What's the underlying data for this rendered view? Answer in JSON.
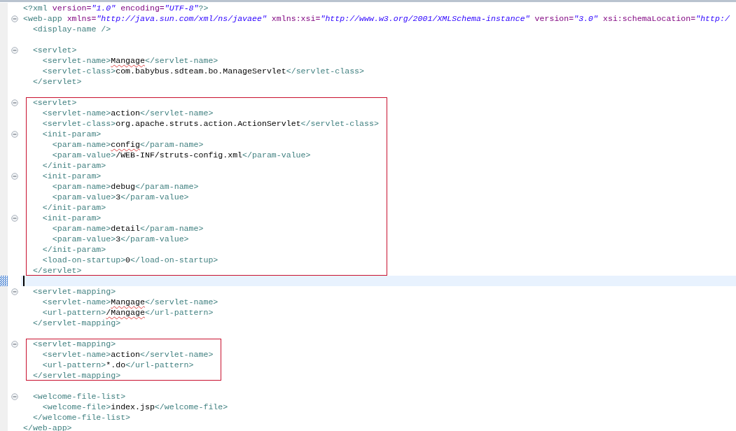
{
  "editor": {
    "lines": [
      {
        "kind": "code",
        "foldable": false,
        "current": false,
        "tokens": [
          {
            "kind": "pi",
            "text": "<?xml "
          },
          {
            "kind": "attr",
            "text": "version="
          },
          {
            "kind": "value",
            "text": "\"1.0\""
          },
          {
            "kind": "attr",
            "text": " encoding="
          },
          {
            "kind": "value",
            "text": "\"UTF-8\""
          },
          {
            "kind": "pi",
            "text": "?>"
          }
        ]
      },
      {
        "kind": "code",
        "foldable": true,
        "current": false,
        "tokens": [
          {
            "kind": "tag",
            "text": "<web-app"
          },
          {
            "kind": "attr",
            "text": " xmlns="
          },
          {
            "kind": "value",
            "text": "\"http://java.sun.com/xml/ns/javaee\""
          },
          {
            "kind": "attr",
            "text": " xmlns:xsi="
          },
          {
            "kind": "value",
            "text": "\"http://www.w3.org/2001/XMLSchema-instance\""
          },
          {
            "kind": "attr",
            "text": " version="
          },
          {
            "kind": "value",
            "text": "\"3.0\""
          },
          {
            "kind": "attr",
            "text": " xsi:schemaLocation="
          },
          {
            "kind": "value",
            "text": "\"http:/"
          }
        ],
        "children": [
          {
            "kind": "code",
            "foldable": false,
            "current": false,
            "tokens": [
              {
                "kind": "tag",
                "text": "<display-name />"
              }
            ]
          },
          {
            "kind": "blank",
            "foldable": false,
            "current": false
          },
          {
            "kind": "code",
            "foldable": true,
            "current": false,
            "tokens": [
              {
                "kind": "tag",
                "text": "<servlet>"
              }
            ],
            "children": [
              {
                "kind": "code",
                "foldable": false,
                "current": false,
                "tokens": [
                  {
                    "kind": "tag",
                    "text": "<servlet-name>"
                  },
                  {
                    "kind": "text",
                    "text": "Mangage",
                    "misspelled": true
                  },
                  {
                    "kind": "tag",
                    "text": "</servlet-name>"
                  }
                ]
              },
              {
                "kind": "code",
                "foldable": false,
                "current": false,
                "tokens": [
                  {
                    "kind": "tag",
                    "text": "<servlet-class>"
                  },
                  {
                    "kind": "text",
                    "text": "com.babybus.sdteam.bo.ManageServlet",
                    "misspelled": false
                  },
                  {
                    "kind": "tag",
                    "text": "</servlet-class>"
                  }
                ]
              }
            ]
          },
          {
            "kind": "code",
            "foldable": false,
            "current": false,
            "tokens": [
              {
                "kind": "tag",
                "text": "</servlet>"
              }
            ]
          },
          {
            "kind": "blank",
            "foldable": false,
            "current": false
          },
          {
            "kind": "frame",
            "lines": [
              {
                "kind": "code",
                "foldable": true,
                "current": false,
                "tokens": [
                  {
                    "kind": "tag",
                    "text": "<servlet>"
                  }
                ],
                "children": [
                  {
                    "kind": "code",
                    "foldable": false,
                    "current": false,
                    "tokens": [
                      {
                        "kind": "tag",
                        "text": "<servlet-name>"
                      },
                      {
                        "kind": "text",
                        "text": "action",
                        "misspelled": false
                      },
                      {
                        "kind": "tag",
                        "text": "</servlet-name>"
                      }
                    ]
                  },
                  {
                    "kind": "code",
                    "foldable": false,
                    "current": false,
                    "tokens": [
                      {
                        "kind": "tag",
                        "text": "<servlet-class>"
                      },
                      {
                        "kind": "text",
                        "text": "org.apache.struts.action.ActionServlet",
                        "misspelled": false
                      },
                      {
                        "kind": "tag",
                        "text": "</servlet-class>"
                      }
                    ]
                  },
                  {
                    "kind": "code",
                    "foldable": true,
                    "current": false,
                    "tokens": [
                      {
                        "kind": "tag",
                        "text": "<init-param>"
                      }
                    ],
                    "children": [
                      {
                        "kind": "code",
                        "foldable": false,
                        "current": false,
                        "tokens": [
                          {
                            "kind": "tag",
                            "text": "<param-name>"
                          },
                          {
                            "kind": "text",
                            "text": "config",
                            "misspelled": true
                          },
                          {
                            "kind": "tag",
                            "text": "</param-name>"
                          }
                        ]
                      },
                      {
                        "kind": "code",
                        "foldable": false,
                        "current": false,
                        "tokens": [
                          {
                            "kind": "tag",
                            "text": "<param-value>"
                          },
                          {
                            "kind": "text",
                            "text": "/WEB-INF/struts-config.xml",
                            "misspelled": false
                          },
                          {
                            "kind": "tag",
                            "text": "</param-value>"
                          }
                        ]
                      }
                    ]
                  },
                  {
                    "kind": "code",
                    "foldable": false,
                    "current": false,
                    "tokens": [
                      {
                        "kind": "tag",
                        "text": "</init-param>"
                      }
                    ]
                  },
                  {
                    "kind": "code",
                    "foldable": true,
                    "current": false,
                    "tokens": [
                      {
                        "kind": "tag",
                        "text": "<init-param>"
                      }
                    ],
                    "children": [
                      {
                        "kind": "code",
                        "foldable": false,
                        "current": false,
                        "tokens": [
                          {
                            "kind": "tag",
                            "text": "<param-name>"
                          },
                          {
                            "kind": "text",
                            "text": "debug",
                            "misspelled": false
                          },
                          {
                            "kind": "tag",
                            "text": "</param-name>"
                          }
                        ]
                      },
                      {
                        "kind": "code",
                        "foldable": false,
                        "current": false,
                        "tokens": [
                          {
                            "kind": "tag",
                            "text": "<param-value>"
                          },
                          {
                            "kind": "text",
                            "text": "3",
                            "misspelled": false
                          },
                          {
                            "kind": "tag",
                            "text": "</param-value>"
                          }
                        ]
                      }
                    ]
                  },
                  {
                    "kind": "code",
                    "foldable": false,
                    "current": false,
                    "tokens": [
                      {
                        "kind": "tag",
                        "text": "</init-param>"
                      }
                    ]
                  },
                  {
                    "kind": "code",
                    "foldable": true,
                    "current": false,
                    "tokens": [
                      {
                        "kind": "tag",
                        "text": "<init-param>"
                      }
                    ],
                    "children": [
                      {
                        "kind": "code",
                        "foldable": false,
                        "current": false,
                        "tokens": [
                          {
                            "kind": "tag",
                            "text": "<param-name>"
                          },
                          {
                            "kind": "text",
                            "text": "detail",
                            "misspelled": false
                          },
                          {
                            "kind": "tag",
                            "text": "</param-name>"
                          }
                        ]
                      },
                      {
                        "kind": "code",
                        "foldable": false,
                        "current": false,
                        "tokens": [
                          {
                            "kind": "tag",
                            "text": "<param-value>"
                          },
                          {
                            "kind": "text",
                            "text": "3",
                            "misspelled": false
                          },
                          {
                            "kind": "tag",
                            "text": "</param-value>"
                          }
                        ]
                      }
                    ]
                  },
                  {
                    "kind": "code",
                    "foldable": false,
                    "current": false,
                    "tokens": [
                      {
                        "kind": "tag",
                        "text": "</init-param>"
                      }
                    ]
                  },
                  {
                    "kind": "code",
                    "foldable": false,
                    "current": false,
                    "tokens": [
                      {
                        "kind": "tag",
                        "text": "<load-on-startup>"
                      },
                      {
                        "kind": "text",
                        "text": "0",
                        "misspelled": false
                      },
                      {
                        "kind": "tag",
                        "text": "</load-on-startup>"
                      }
                    ]
                  }
                ]
              },
              {
                "kind": "code",
                "foldable": false,
                "current": false,
                "tokens": [
                  {
                    "kind": "tag",
                    "text": "</servlet>"
                  }
                ]
              }
            ]
          },
          {
            "kind": "blank",
            "foldable": false,
            "current": true
          },
          {
            "kind": "code",
            "foldable": true,
            "current": false,
            "tokens": [
              {
                "kind": "tag",
                "text": "<servlet-mapping>"
              }
            ],
            "children": [
              {
                "kind": "code",
                "foldable": false,
                "current": false,
                "tokens": [
                  {
                    "kind": "tag",
                    "text": "<servlet-name>"
                  },
                  {
                    "kind": "text",
                    "text": "Mangage",
                    "misspelled": true
                  },
                  {
                    "kind": "tag",
                    "text": "</servlet-name>"
                  }
                ]
              },
              {
                "kind": "code",
                "foldable": false,
                "current": false,
                "tokens": [
                  {
                    "kind": "tag",
                    "text": "<url-pattern>"
                  },
                  {
                    "kind": "text",
                    "text": "/Mangage",
                    "misspelled": true
                  },
                  {
                    "kind": "tag",
                    "text": "</url-pattern>"
                  }
                ]
              }
            ]
          },
          {
            "kind": "code",
            "foldable": false,
            "current": false,
            "tokens": [
              {
                "kind": "tag",
                "text": "</servlet-mapping>"
              }
            ]
          },
          {
            "kind": "blank",
            "foldable": false,
            "current": false
          },
          {
            "kind": "frame",
            "lines": [
              {
                "kind": "code",
                "foldable": true,
                "current": false,
                "tokens": [
                  {
                    "kind": "tag",
                    "text": "<servlet-mapping>"
                  }
                ],
                "children": [
                  {
                    "kind": "code",
                    "foldable": false,
                    "current": false,
                    "tokens": [
                      {
                        "kind": "tag",
                        "text": "<servlet-name>"
                      },
                      {
                        "kind": "text",
                        "text": "action",
                        "misspelled": false
                      },
                      {
                        "kind": "tag",
                        "text": "</servlet-name>"
                      }
                    ]
                  },
                  {
                    "kind": "code",
                    "foldable": false,
                    "current": false,
                    "tokens": [
                      {
                        "kind": "tag",
                        "text": "<url-pattern>"
                      },
                      {
                        "kind": "text",
                        "text": "*.do",
                        "misspelled": false
                      },
                      {
                        "kind": "tag",
                        "text": "</url-pattern>"
                      }
                    ]
                  }
                ]
              },
              {
                "kind": "code",
                "foldable": false,
                "current": false,
                "tokens": [
                  {
                    "kind": "tag",
                    "text": "</servlet-mapping>"
                  }
                ]
              }
            ]
          },
          {
            "kind": "blank",
            "foldable": false,
            "current": false
          },
          {
            "kind": "code",
            "foldable": true,
            "current": false,
            "tokens": [
              {
                "kind": "tag",
                "text": "<welcome-file-list>"
              }
            ],
            "children": [
              {
                "kind": "code",
                "foldable": false,
                "current": false,
                "tokens": [
                  {
                    "kind": "tag",
                    "text": "<welcome-file>"
                  },
                  {
                    "kind": "text",
                    "text": "index.jsp",
                    "misspelled": false
                  },
                  {
                    "kind": "tag",
                    "text": "</welcome-file>"
                  }
                ]
              }
            ]
          },
          {
            "kind": "code",
            "foldable": false,
            "current": false,
            "tokens": [
              {
                "kind": "tag",
                "text": "</welcome-file-list>"
              }
            ]
          }
        ]
      },
      {
        "kind": "code",
        "foldable": false,
        "current": false,
        "tokens": [
          {
            "kind": "tag",
            "text": "</web-app>"
          }
        ]
      }
    ]
  }
}
